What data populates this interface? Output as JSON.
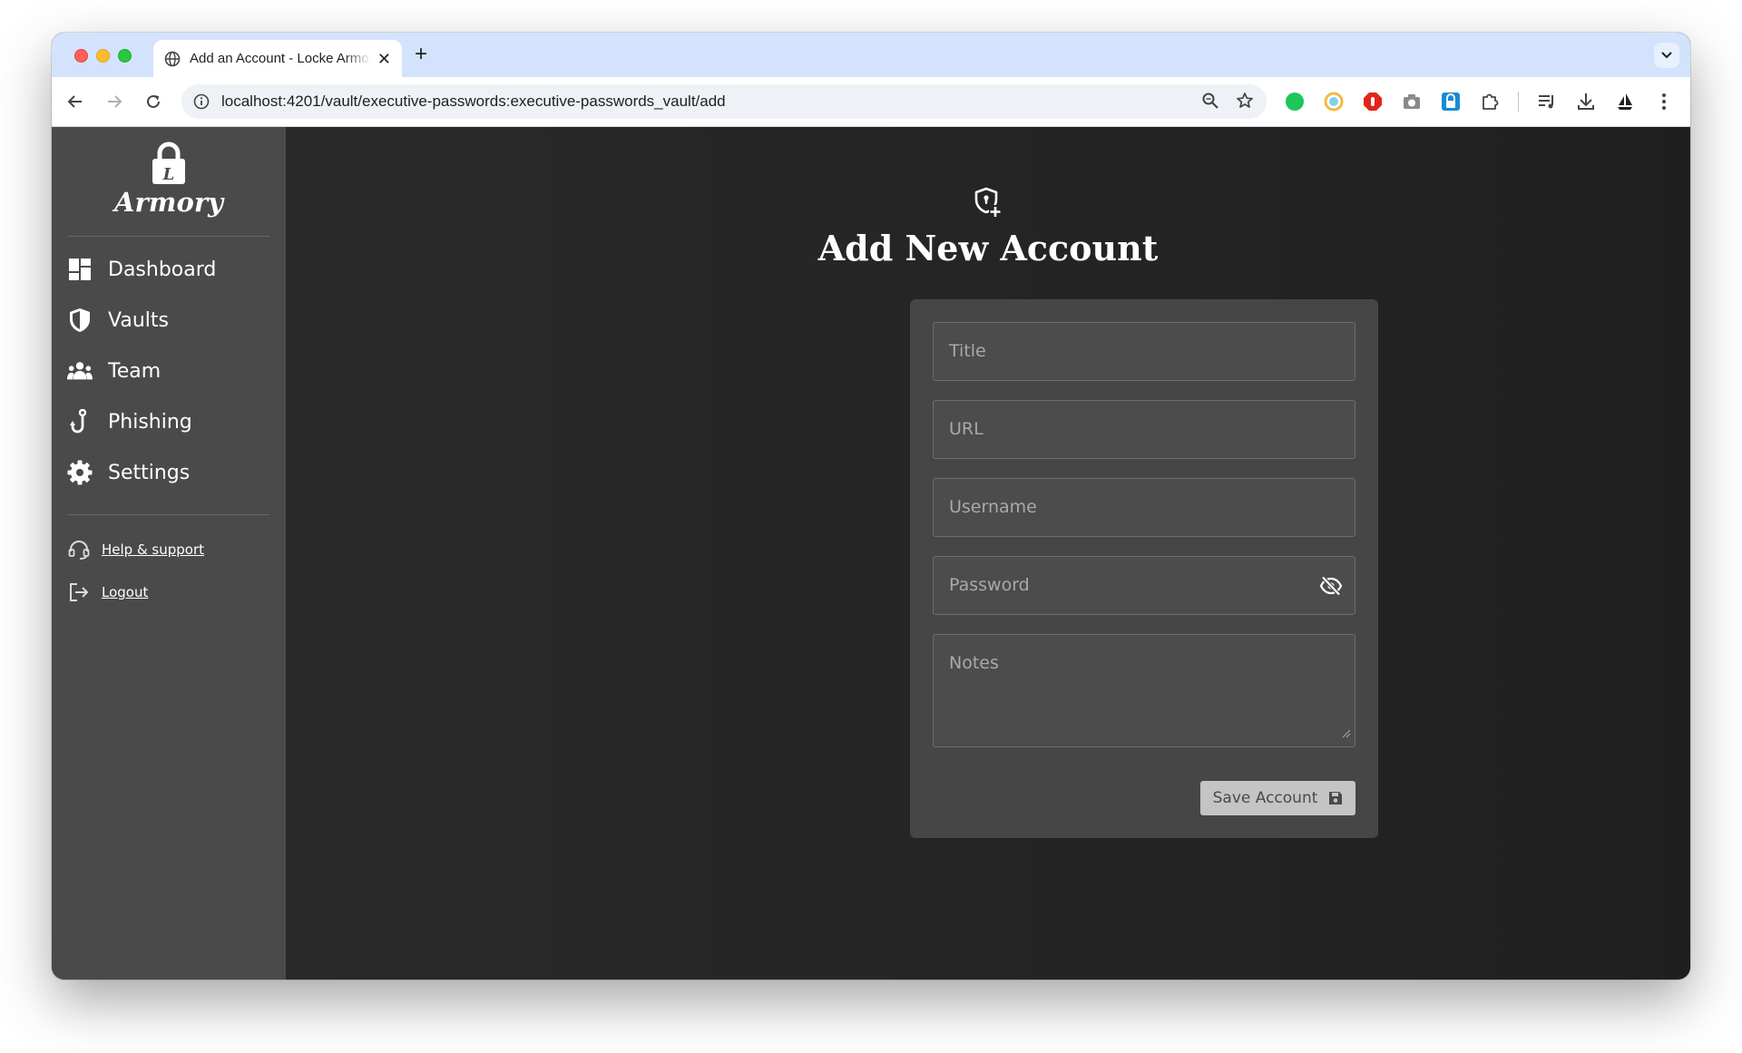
{
  "browser": {
    "tab_title": "Add an Account - Locke Armory",
    "url": "localhost:4201/vault/executive-passwords:executive-passwords_vault/add"
  },
  "sidebar": {
    "logo_text": "Armory",
    "nav": [
      {
        "label": "Dashboard",
        "icon": "dashboard-icon"
      },
      {
        "label": "Vaults",
        "icon": "shield-icon"
      },
      {
        "label": "Team",
        "icon": "team-icon"
      },
      {
        "label": "Phishing",
        "icon": "fishhook-icon"
      },
      {
        "label": "Settings",
        "icon": "gear-icon"
      }
    ],
    "help_label": "Help & support",
    "logout_label": "Logout"
  },
  "main": {
    "title": "Add New Account",
    "form": {
      "title_placeholder": "Title",
      "url_placeholder": "URL",
      "username_placeholder": "Username",
      "password_placeholder": "Password",
      "notes_placeholder": "Notes",
      "save_label": "Save Account"
    }
  },
  "colors": {
    "sidebar_bg": "#4a4a4a",
    "main_bg": "#242424",
    "card_bg": "#464646",
    "button_bg": "#c4c4c4"
  }
}
